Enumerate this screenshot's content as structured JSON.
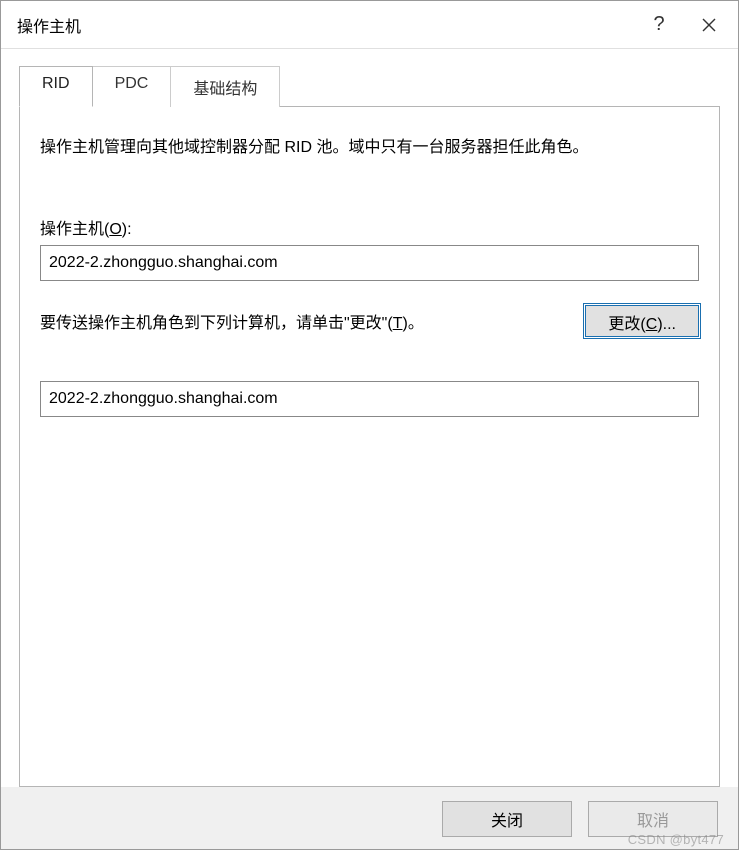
{
  "titlebar": {
    "title": "操作主机",
    "help_label": "?",
    "close_label": "✕"
  },
  "tabs": {
    "rid": "RID",
    "pdc": "PDC",
    "infra": "基础结构"
  },
  "panel": {
    "description": "操作主机管理向其他域控制器分配 RID 池。域中只有一台服务器担任此角色。",
    "host_label_prefix": "操作主机(",
    "host_label_hotkey": "O",
    "host_label_suffix": "):",
    "host_value": "2022-2.zhongguo.shanghai.com",
    "transfer_prefix": "要传送操作主机角色到下列计算机，请单击\"更改\"(",
    "transfer_hotkey": "T",
    "transfer_suffix": ")。",
    "change_btn_prefix": "更改(",
    "change_btn_hotkey": "C",
    "change_btn_suffix": ")...",
    "target_value": "2022-2.zhongguo.shanghai.com"
  },
  "buttons": {
    "close": "关闭",
    "cancel": "取消"
  },
  "watermark": "CSDN @byt477"
}
